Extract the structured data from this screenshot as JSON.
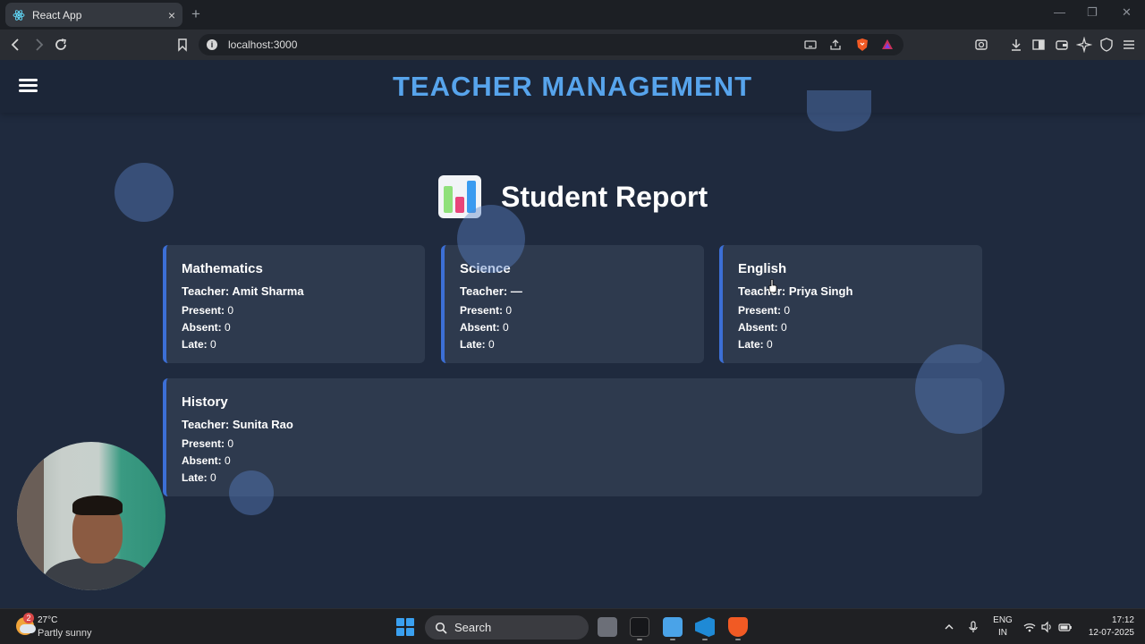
{
  "browser": {
    "tab_title": "React App",
    "tab_close": "×",
    "new_tab": "+",
    "url": "localhost:3000"
  },
  "app": {
    "title": "TEACHER MANAGEMENT",
    "report_title": "Student Report",
    "accent": "#57a4ec",
    "card_border": "#3c6fd6"
  },
  "labels": {
    "teacher": "Teacher:",
    "present": "Present:",
    "absent": "Absent:",
    "late": "Late:"
  },
  "cards": [
    {
      "subject": "Mathematics",
      "teacher": "Amit Sharma",
      "present": "0",
      "absent": "0",
      "late": "0"
    },
    {
      "subject": "Science",
      "teacher": "—",
      "present": "0",
      "absent": "0",
      "late": "0"
    },
    {
      "subject": "English",
      "teacher": "Priya Singh",
      "present": "0",
      "absent": "0",
      "late": "0"
    },
    {
      "subject": "History",
      "teacher": "Sunita Rao",
      "present": "0",
      "absent": "0",
      "late": "0"
    }
  ],
  "taskbar": {
    "weather_badge": "2",
    "temperature": "27°C",
    "condition": "Partly sunny",
    "search_label": "Search",
    "lang_top": "ENG",
    "lang_bottom": "IN",
    "time": "17:12",
    "date": "12-07-2025"
  }
}
